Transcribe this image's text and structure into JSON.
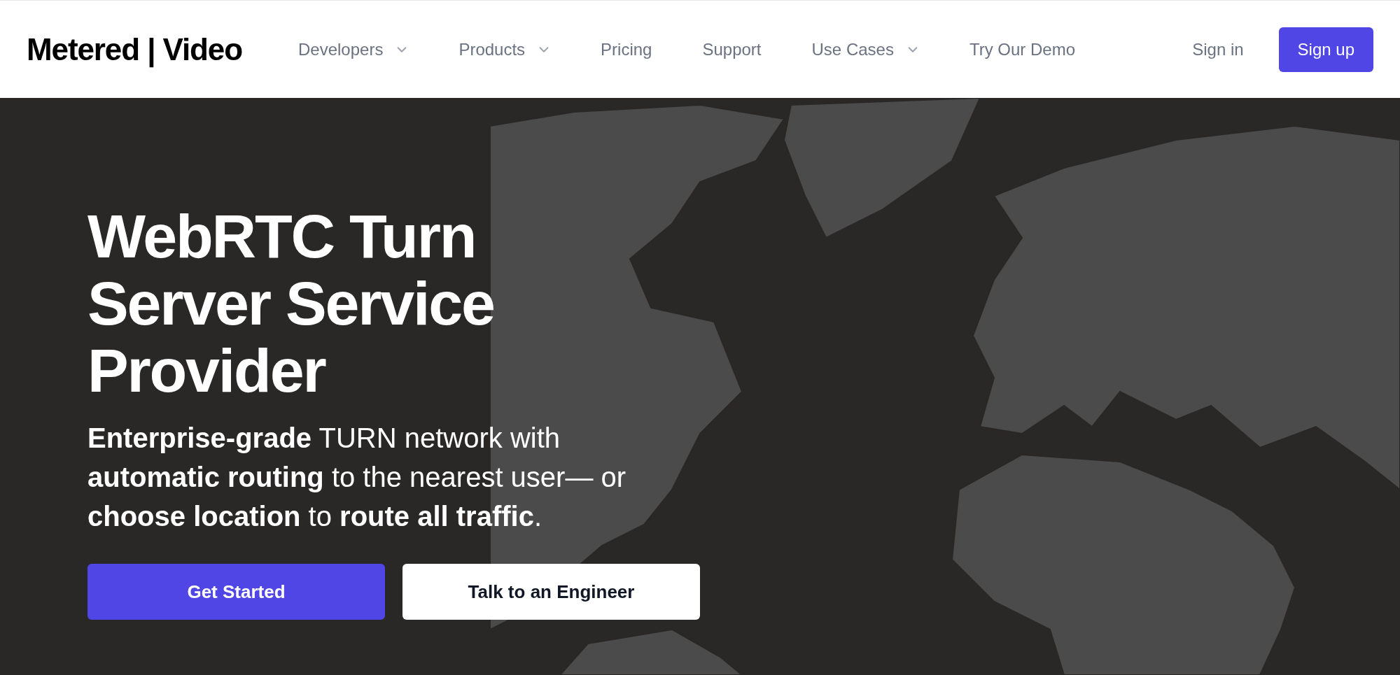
{
  "header": {
    "logo": "Metered | Video",
    "nav": [
      {
        "label": "Developers",
        "has_dropdown": true
      },
      {
        "label": "Products",
        "has_dropdown": true
      },
      {
        "label": "Pricing",
        "has_dropdown": false
      },
      {
        "label": "Support",
        "has_dropdown": false
      },
      {
        "label": "Use Cases",
        "has_dropdown": true
      },
      {
        "label": "Try Our Demo",
        "has_dropdown": false
      }
    ],
    "sign_in": "Sign in",
    "sign_up": "Sign up"
  },
  "hero": {
    "title": "WebRTC Turn Server Service Provider",
    "subtitle": "**Enterprise-grade** TURN network with **automatic routing** to the nearest user— or **choose location** to **route all traffic**.",
    "buttons": [
      {
        "label": "Get Started",
        "kind": "primary"
      },
      {
        "label": "Talk to an Engineer",
        "kind": "secondary"
      }
    ]
  }
}
